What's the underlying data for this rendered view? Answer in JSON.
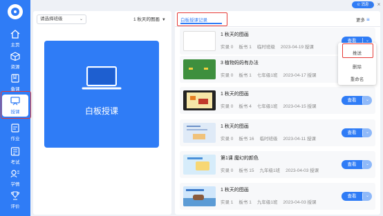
{
  "sidebar": {
    "items": [
      {
        "label": "主页",
        "icon": "home-icon"
      },
      {
        "label": "资源",
        "icon": "cube-icon"
      },
      {
        "label": "备课",
        "icon": "book-icon"
      },
      {
        "label": "授课",
        "icon": "board-icon",
        "active": true
      },
      {
        "label": "作业",
        "icon": "homework-icon"
      },
      {
        "label": "考试",
        "icon": "exam-icon"
      },
      {
        "label": "学情",
        "icon": "chart-icon"
      },
      {
        "label": "评价",
        "icon": "trophy-icon"
      }
    ]
  },
  "topbar": {
    "help_label": "⊙ 消息",
    "minimize": "–",
    "maximize": "□",
    "close": "×"
  },
  "left_panel": {
    "class_select_placeholder": "请选择班级",
    "lesson_select_value": "1 秋天的图画",
    "board_card_label": "白板授课"
  },
  "right_panel": {
    "tab_label": "白板授课记录",
    "more_label": "更多",
    "view_label": "查看",
    "records": [
      {
        "title": "1 秋天的图画",
        "record": "实录 0",
        "boards": "板书 1",
        "class": "临时班级",
        "date": "2023-04-19 授课"
      },
      {
        "title": "3 植物妈妈有办法",
        "record": "实录 0",
        "boards": "板书 1",
        "class": "七年级1班",
        "date": "2023-04-17 授课"
      },
      {
        "title": "1 秋天的图画",
        "record": "实录 0",
        "boards": "板书 4",
        "class": "七年级1班",
        "date": "2023-04-15 授课"
      },
      {
        "title": "1 秋天的图画",
        "record": "实录 0",
        "boards": "板书 16",
        "class": "临时班级",
        "date": "2023-04-11 授课"
      },
      {
        "title": "第1课 魔幻的颜色",
        "record": "实录 0",
        "boards": "板书 15",
        "class": "九年级1班",
        "date": "2023-04-03 授课"
      },
      {
        "title": "1 秋天的图画",
        "record": "实录 1",
        "boards": "板书 1",
        "class": "九年级1班",
        "date": "2023-04-03 授课"
      }
    ]
  },
  "dropdown": {
    "items": [
      "推送",
      "删除",
      "重命名"
    ]
  },
  "colors": {
    "accent": "#2f7cf6",
    "highlight": "#e53935"
  }
}
